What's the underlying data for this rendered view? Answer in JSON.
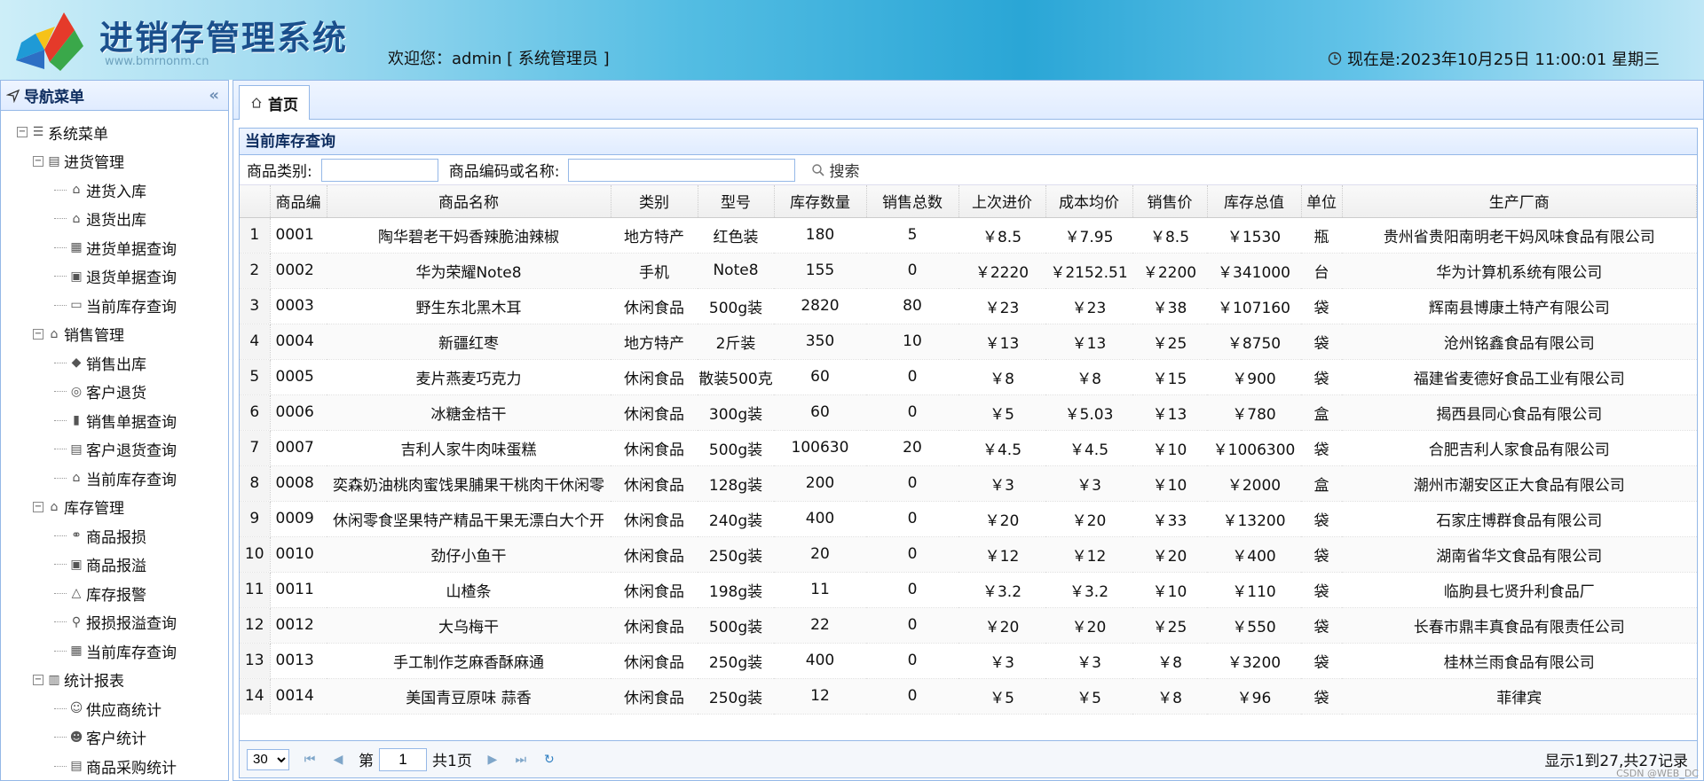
{
  "app": {
    "title": "进销存管理系统",
    "watermark": "www.bmrnonm.cn",
    "welcome": "欢迎您：admin [ 系统管理员 ]",
    "clock": "现在是:2023年10月25日 11:00:01 星期三"
  },
  "sidebar": {
    "title": "导航菜单",
    "collapse": "«",
    "root": "系统菜单",
    "groups": [
      {
        "label": "进货管理",
        "icon": "clipboard-icon",
        "items": [
          {
            "label": "进货入库",
            "icon": "warehouse-in-icon"
          },
          {
            "label": "退货出库",
            "icon": "warehouse-out-icon"
          },
          {
            "label": "进货单据查询",
            "icon": "receipt-search-icon"
          },
          {
            "label": "退货单据查询",
            "icon": "invoice-icon"
          },
          {
            "label": "当前库存查询",
            "icon": "box-icon"
          }
        ]
      },
      {
        "label": "销售管理",
        "icon": "shop-icon",
        "items": [
          {
            "label": "销售出库",
            "icon": "tag-icon"
          },
          {
            "label": "客户退货",
            "icon": "coin-icon"
          },
          {
            "label": "销售单据查询",
            "icon": "document-icon"
          },
          {
            "label": "客户退货查询",
            "icon": "receipt-icon"
          },
          {
            "label": "当前库存查询",
            "icon": "home-icon"
          }
        ]
      },
      {
        "label": "库存管理",
        "icon": "storehouse-icon",
        "items": [
          {
            "label": "商品报损",
            "icon": "broken-icon"
          },
          {
            "label": "商品报溢",
            "icon": "surplus-icon"
          },
          {
            "label": "库存报警",
            "icon": "warning-icon"
          },
          {
            "label": "报损报溢查询",
            "icon": "magnifier-icon"
          },
          {
            "label": "当前库存查询",
            "icon": "grid-icon"
          }
        ]
      },
      {
        "label": "统计报表",
        "icon": "bar-chart-icon",
        "items": [
          {
            "label": "供应商统计",
            "icon": "supplier-icon"
          },
          {
            "label": "客户统计",
            "icon": "users-icon"
          },
          {
            "label": "商品采购统计",
            "icon": "report-icon"
          }
        ]
      }
    ]
  },
  "tabs": [
    {
      "label": "首页",
      "icon": "home-icon"
    }
  ],
  "panel": {
    "title": "当前库存查询"
  },
  "search": {
    "category_label": "商品类别:",
    "code_label": "商品编码或名称:",
    "button_label": "搜索",
    "category_value": "",
    "code_value": ""
  },
  "table": {
    "headers": [
      "",
      "商品编",
      "商品名称",
      "类别",
      "型号",
      "库存数量",
      "销售总数",
      "上次进价",
      "成本均价",
      "销售价",
      "库存总值",
      "单位",
      "生产厂商"
    ],
    "rows": [
      [
        "1",
        "0001",
        "陶华碧老干妈香辣脆油辣椒",
        "地方特产",
        "红色装",
        "180",
        "5",
        "￥8.5",
        "￥7.95",
        "￥8.5",
        "￥1530",
        "瓶",
        "贵州省贵阳南明老干妈风味食品有限公司"
      ],
      [
        "2",
        "0002",
        "华为荣耀Note8",
        "手机",
        "Note8",
        "155",
        "0",
        "￥2220",
        "￥2152.51",
        "￥2200",
        "￥341000",
        "台",
        "华为计算机系统有限公司"
      ],
      [
        "3",
        "0003",
        "野生东北黑木耳",
        "休闲食品",
        "500g装",
        "2820",
        "80",
        "￥23",
        "￥23",
        "￥38",
        "￥107160",
        "袋",
        "辉南县博康土特产有限公司"
      ],
      [
        "4",
        "0004",
        "新疆红枣",
        "地方特产",
        "2斤装",
        "350",
        "10",
        "￥13",
        "￥13",
        "￥25",
        "￥8750",
        "袋",
        "沧州铭鑫食品有限公司"
      ],
      [
        "5",
        "0005",
        "麦片燕麦巧克力",
        "休闲食品",
        "散装500克",
        "60",
        "0",
        "￥8",
        "￥8",
        "￥15",
        "￥900",
        "袋",
        "福建省麦德好食品工业有限公司"
      ],
      [
        "6",
        "0006",
        "冰糖金桔干",
        "休闲食品",
        "300g装",
        "60",
        "0",
        "￥5",
        "￥5.03",
        "￥13",
        "￥780",
        "盒",
        "揭西县同心食品有限公司"
      ],
      [
        "7",
        "0007",
        "吉利人家牛肉味蛋糕",
        "休闲食品",
        "500g装",
        "100630",
        "20",
        "￥4.5",
        "￥4.5",
        "￥10",
        "￥1006300",
        "袋",
        "合肥吉利人家食品有限公司"
      ],
      [
        "8",
        "0008",
        "奕森奶油桃肉蜜饯果脯果干桃肉干休闲零",
        "休闲食品",
        "128g装",
        "200",
        "0",
        "￥3",
        "￥3",
        "￥10",
        "￥2000",
        "盒",
        "潮州市潮安区正大食品有限公司"
      ],
      [
        "9",
        "0009",
        "休闲零食坚果特产精品干果无漂白大个开",
        "休闲食品",
        "240g装",
        "400",
        "0",
        "￥20",
        "￥20",
        "￥33",
        "￥13200",
        "袋",
        "石家庄博群食品有限公司"
      ],
      [
        "10",
        "0010",
        "劲仔小鱼干",
        "休闲食品",
        "250g装",
        "20",
        "0",
        "￥12",
        "￥12",
        "￥20",
        "￥400",
        "袋",
        "湖南省华文食品有限公司"
      ],
      [
        "11",
        "0011",
        "山楂条",
        "休闲食品",
        "198g装",
        "11",
        "0",
        "￥3.2",
        "￥3.2",
        "￥10",
        "￥110",
        "袋",
        "临朐县七贤升利食品厂"
      ],
      [
        "12",
        "0012",
        "大乌梅干",
        "休闲食品",
        "500g装",
        "22",
        "0",
        "￥20",
        "￥20",
        "￥25",
        "￥550",
        "袋",
        "长春市鼎丰真食品有限责任公司"
      ],
      [
        "13",
        "0013",
        "手工制作芝麻香酥麻通",
        "休闲食品",
        "250g装",
        "400",
        "0",
        "￥3",
        "￥3",
        "￥8",
        "￥3200",
        "袋",
        "桂林兰雨食品有限公司"
      ],
      [
        "14",
        "0014",
        "美国青豆原味 蒜香",
        "休闲食品",
        "250g装",
        "12",
        "0",
        "￥5",
        "￥5",
        "￥8",
        "￥96",
        "袋",
        "菲律宾"
      ]
    ]
  },
  "pager": {
    "page_size": "30",
    "page_prefix": "第",
    "page": "1",
    "page_suffix": "共1页",
    "info": "显示1到27,共27记录"
  },
  "watermark_bottom": "CSDN @WEB_DC"
}
